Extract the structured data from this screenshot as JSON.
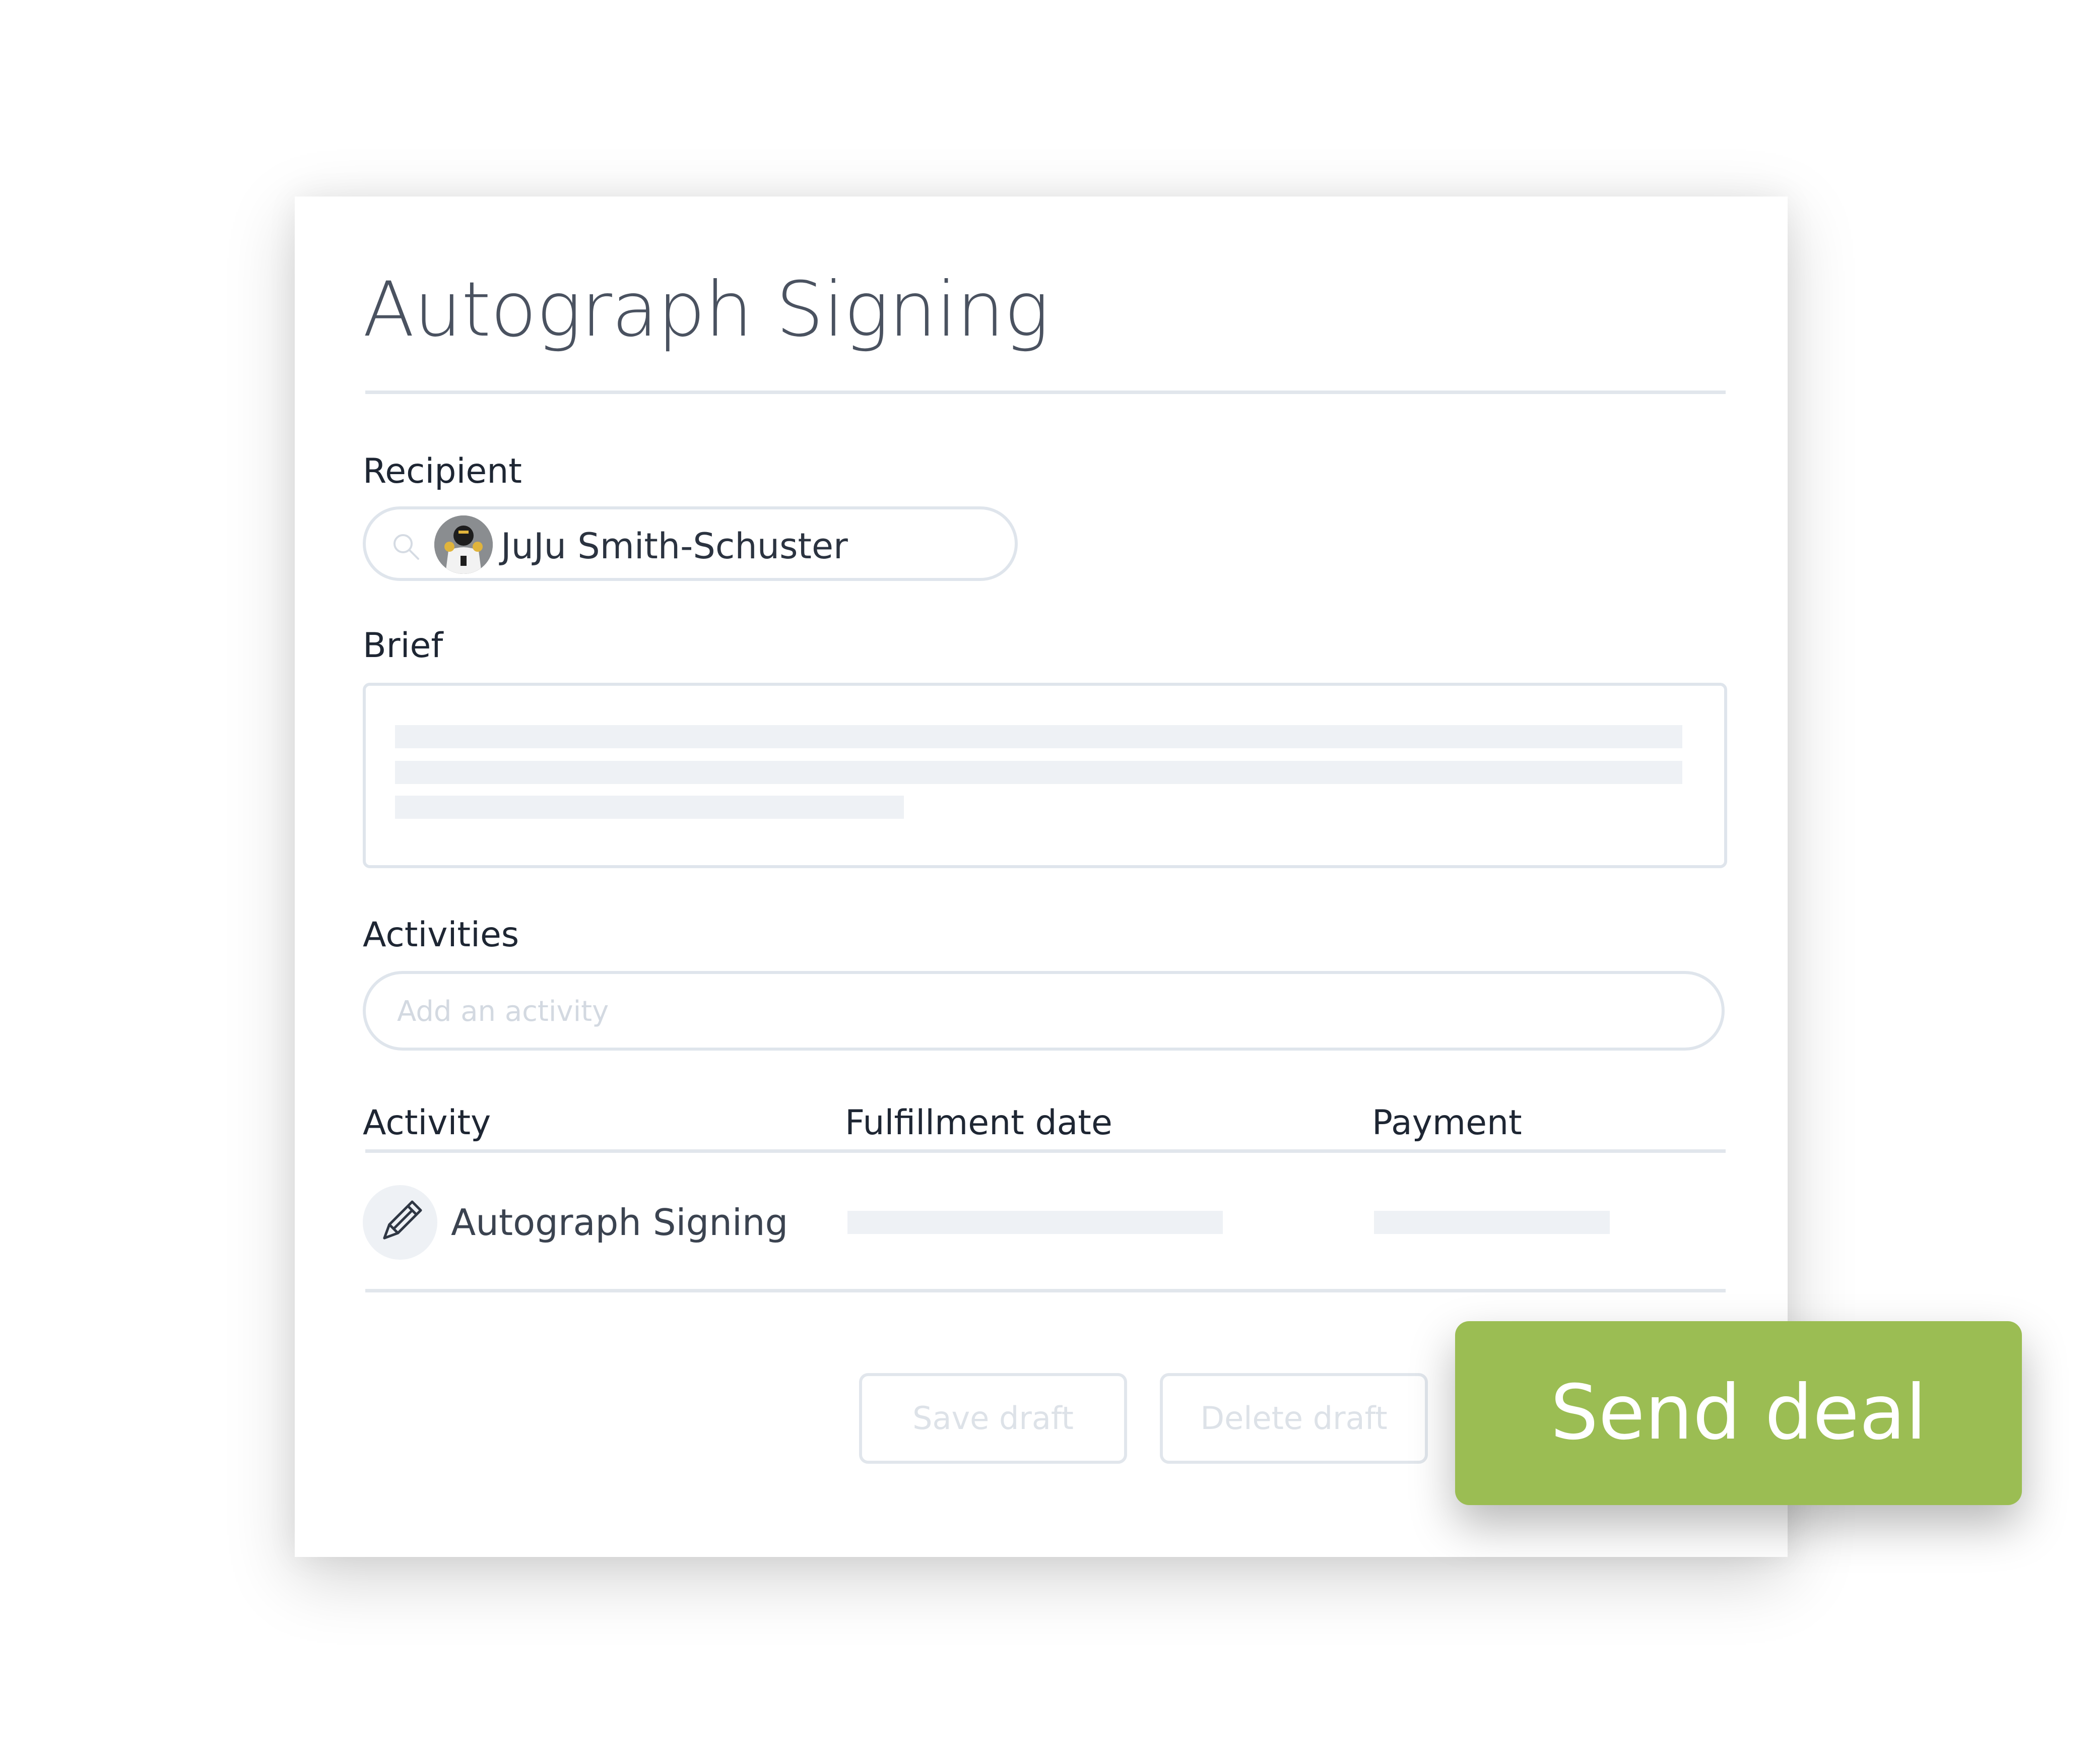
{
  "deal": {
    "title": "Autograph Signing"
  },
  "recipient": {
    "label": "Recipient",
    "name": "JuJu Smith-Schuster"
  },
  "brief": {
    "label": "Brief"
  },
  "activities": {
    "label": "Activities",
    "input_placeholder": "Add an activity"
  },
  "table": {
    "headers": {
      "activity": "Activity",
      "fulfillment_date": "Fulfillment date",
      "payment": "Payment"
    },
    "rows": [
      {
        "activity": "Autograph Signing",
        "icon": "pencil-icon"
      }
    ]
  },
  "actions": {
    "save_draft": "Save draft",
    "delete_draft": "Delete draft",
    "send_deal": "Send deal"
  },
  "colors": {
    "accent": "#9bbd53",
    "border": "#dfe5ec",
    "skeleton": "#eef1f5",
    "title_text": "#4a5260"
  }
}
